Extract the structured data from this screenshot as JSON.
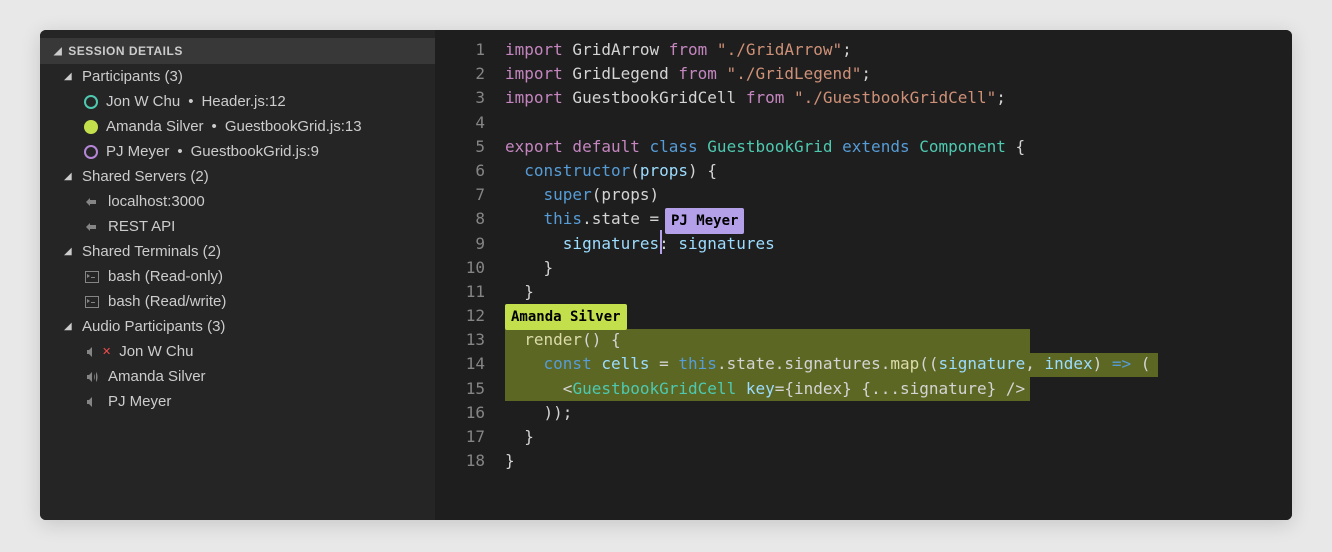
{
  "sidebar": {
    "title": "SESSION DETAILS",
    "sections": {
      "participants": {
        "label": "Participants (3)",
        "items": [
          {
            "name": "Jon W Chu",
            "loc": "Header.js:12"
          },
          {
            "name": "Amanda Silver",
            "loc": "GuestbookGrid.js:13"
          },
          {
            "name": "PJ Meyer",
            "loc": "GuestbookGrid.js:9"
          }
        ]
      },
      "servers": {
        "label": "Shared Servers (2)",
        "items": [
          "localhost:3000",
          "REST API"
        ]
      },
      "terminals": {
        "label": "Shared Terminals (2)",
        "items": [
          "bash (Read-only)",
          "bash (Read/write)"
        ]
      },
      "audio": {
        "label": "Audio Participants (3)",
        "items": [
          "Jon W Chu",
          "Amanda Silver",
          "PJ Meyer"
        ]
      }
    }
  },
  "cursors": {
    "pj": "PJ Meyer",
    "amanda": "Amanda Silver"
  },
  "code": {
    "l1a": "import",
    "l1b": " GridArrow ",
    "l1c": "from",
    "l1d": " \"./GridArrow\"",
    "l1e": ";",
    "l2a": "import",
    "l2b": " GridLegend ",
    "l2c": "from",
    "l2d": " \"./GridLegend\"",
    "l2e": ";",
    "l3a": "import",
    "l3b": " GuestbookGridCell ",
    "l3c": "from",
    "l3d": " \"./GuestbookGridCell\"",
    "l3e": ";",
    "l5a": "export default ",
    "l5b": "class ",
    "l5c": "GuestbookGrid ",
    "l5d": "extends ",
    "l5e": "Component",
    " l5f": " {",
    "l6a": "  ",
    "l6b": "constructor",
    "l6c": "(",
    "l6d": "props",
    "l6e": ") {",
    "l7a": "    ",
    "l7b": "super",
    "l7c": "(props)",
    "l8a": "    ",
    "l8b": "this",
    "l8c": ".state = ",
    "l9a": "      ",
    "l9b": "signatures",
    "l9c": ": ",
    "l9d": "signatures",
    "l10": "    }",
    "l11": "  }",
    "l13a": "  ",
    "l13b": "render",
    "l13c": "() {",
    "l14a": "    ",
    "l14b": "const ",
    "l14c": "cells",
    "l14d": " = ",
    "l14e": "this",
    "l14f": ".state.signatures.",
    "l14g": "map",
    "l14h": "((",
    "l14i": "signature",
    "l14j": ", ",
    "l14k": "index",
    "l14l": ") ",
    "l14m": "=>",
    " l14n": " (",
    "l15a": "      <",
    "l15b": "GuestbookGridCell ",
    "l15c": "key",
    "l15d": "={index} {...signature} />",
    "l16": "    ));",
    "l17": "  }",
    "l18": "}"
  }
}
